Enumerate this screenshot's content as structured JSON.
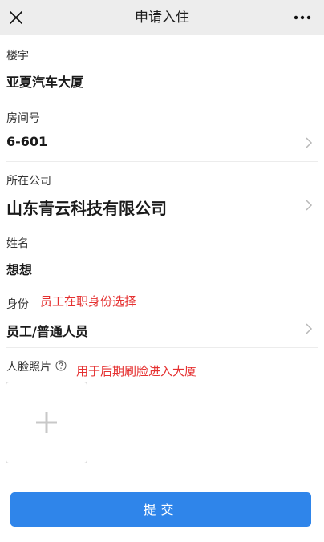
{
  "header": {
    "title": "申请入住",
    "close_icon": "close-icon",
    "more_icon": "more-icon"
  },
  "form": {
    "building": {
      "label": "楼宇",
      "value": "亚夏汽车大厦"
    },
    "room": {
      "label": "房间号",
      "value": "6-601"
    },
    "company": {
      "label": "所在公司",
      "value": "山东青云科技有限公司"
    },
    "name": {
      "label": "姓名",
      "value": "想想"
    },
    "identity": {
      "label": "身份",
      "value": "员工/普通人员",
      "note": "员工在职身份选择"
    },
    "face_photo": {
      "label": "人脸照片",
      "note": "用于后期刷脸进入大厦",
      "help_icon": "question-circle-icon",
      "upload_icon": "plus-icon"
    }
  },
  "submit": {
    "label": "提交"
  },
  "colors": {
    "accent": "#2f85ea",
    "note_red": "#e53131",
    "header_bg": "#ededed"
  }
}
